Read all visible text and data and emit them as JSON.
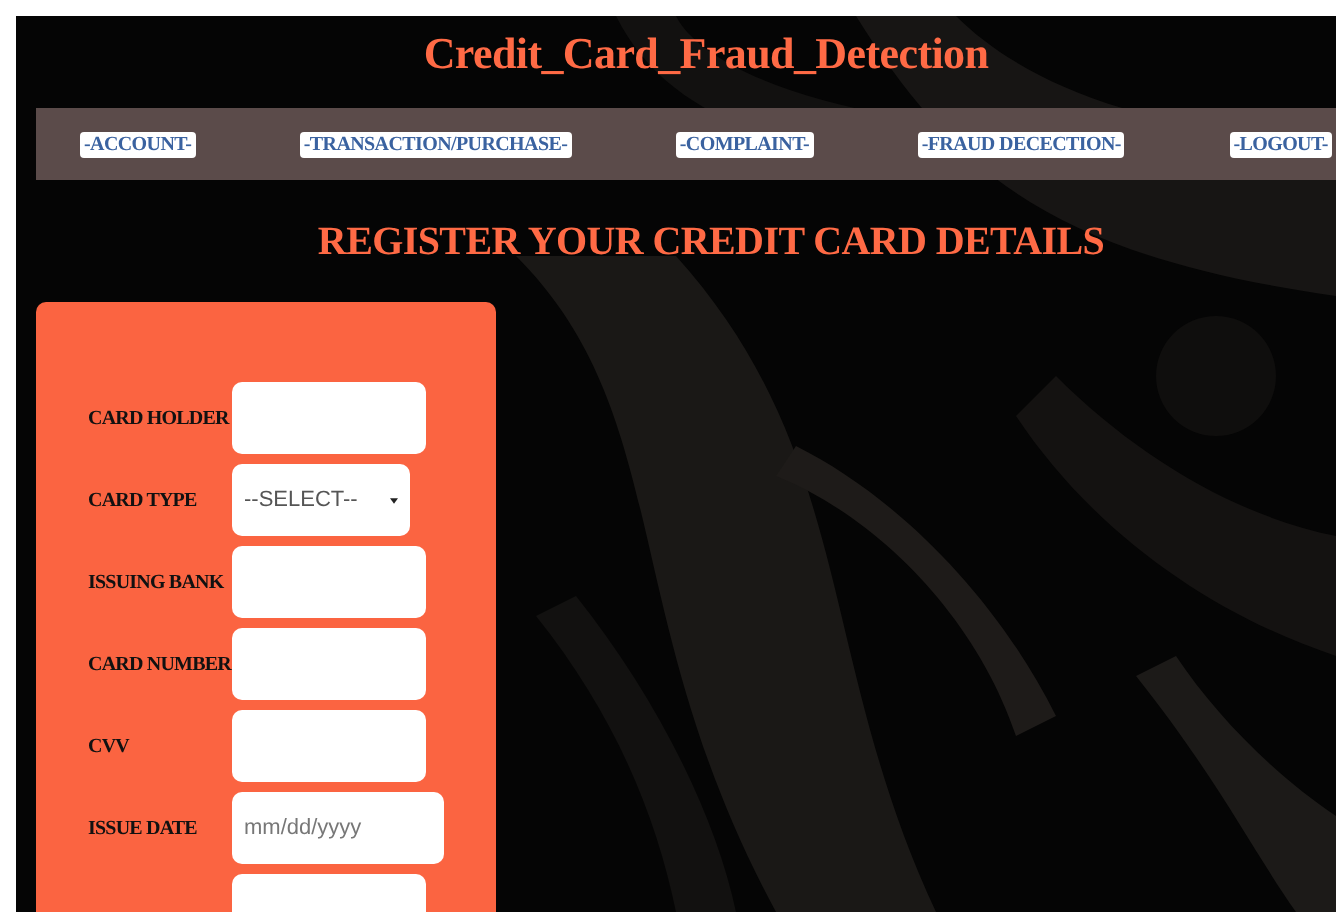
{
  "title": "Credit_Card_Fraud_Detection",
  "nav": [
    {
      "label": "-ACCOUNT-"
    },
    {
      "label": "-TRANSACTION/PURCHASE-"
    },
    {
      "label": "-COMPLAINT-"
    },
    {
      "label": "-FRAUD DECECTION-"
    },
    {
      "label": "-LOGOUT-"
    }
  ],
  "heading": "REGISTER YOUR CREDIT CARD DETAILS",
  "form": [
    {
      "kind": "text",
      "label": "CARD HOLDER"
    },
    {
      "kind": "select",
      "label": "CARD TYPE",
      "value": "--SELECT--"
    },
    {
      "kind": "text",
      "label": "ISSUING BANK"
    },
    {
      "kind": "text",
      "label": "CARD NUMBER"
    },
    {
      "kind": "text",
      "label": "CVV"
    },
    {
      "kind": "date",
      "label": "ISSUE DATE",
      "placeholder": "mm/dd/yyyy"
    },
    {
      "kind": "text"
    }
  ]
}
